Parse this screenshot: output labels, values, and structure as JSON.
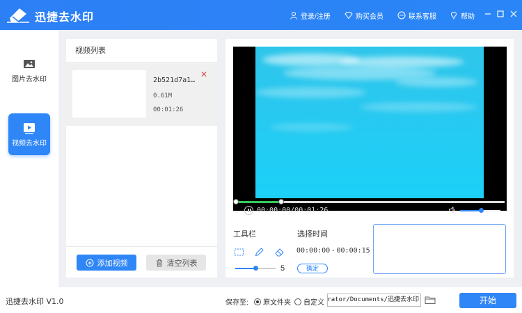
{
  "app": {
    "title": "迅捷去水印"
  },
  "header": {
    "login_label": "登录/注册",
    "buy_label": "购买会员",
    "service_label": "联系客服",
    "help_label": "帮助"
  },
  "sidebar": {
    "items": [
      {
        "label": "图片去水印",
        "icon": "image-icon",
        "active": false
      },
      {
        "label": "视频去水印",
        "icon": "video-play-icon",
        "active": true
      }
    ]
  },
  "video_list": {
    "title": "视频列表",
    "items": [
      {
        "name": "2b521d7a1…",
        "size": "0.61M",
        "duration": "00:01:26"
      }
    ],
    "add_label": "添加视频",
    "clear_label": "清空列表"
  },
  "player": {
    "time_readout": "00:00:00/00:01:26",
    "progress_fraction": 0.17,
    "volume_fraction": 0.52
  },
  "tools": {
    "title": "工具栏",
    "icons": [
      "select-rect-icon",
      "pen-icon",
      "eraser-icon"
    ],
    "brush_size": "5",
    "brush_fraction": 0.5
  },
  "time_select": {
    "title": "选择时间",
    "start": "00:00:00",
    "separator": "-",
    "end": "00:00:15",
    "confirm_label": "确定"
  },
  "footer": {
    "version": "迅捷去水印 V1.0",
    "save_to_label": "保存至:",
    "option_original": "原文件夹",
    "option_custom": "自定义",
    "selected_option": "原文件夹",
    "path": "istrator/Documents/迅捷去水印",
    "start_label": "开始"
  },
  "colors": {
    "accent": "#2f86f6",
    "progress": "#37c85b",
    "close": "#e05050"
  }
}
